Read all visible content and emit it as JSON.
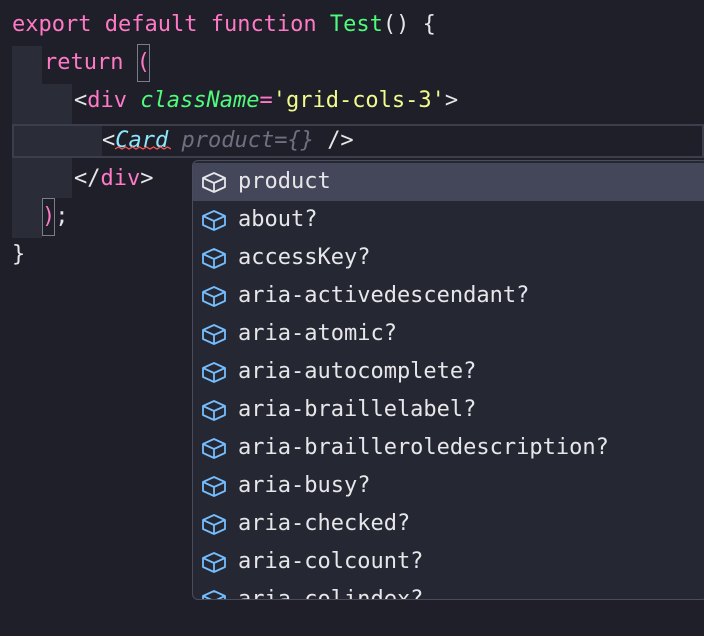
{
  "code": {
    "line1": {
      "kw_export": "export",
      "kw_default": "default",
      "kw_function": "function",
      "fn_name": "Test",
      "parens_brace": "() {"
    },
    "line2": {
      "kw_return": "return",
      "open_paren": "("
    },
    "line3": {
      "lt": "<",
      "tag": "div",
      "attr": "className",
      "eq": "=",
      "value": "'grid-cols-3'",
      "gt": ">"
    },
    "line4": {
      "lt": "<",
      "component": "Card",
      "ghost_hint": "product={}",
      "close": "/>"
    },
    "line5": {
      "close_tag_open": "</",
      "tag": "div",
      "gt": ">"
    },
    "line6": {
      "close_paren": ")",
      "semicolon": ";"
    },
    "line7": {
      "brace": "}"
    }
  },
  "suggestions": {
    "icon": "cube-icon",
    "selected_index": 0,
    "items": [
      "product",
      "about?",
      "accessKey?",
      "aria-activedescendant?",
      "aria-atomic?",
      "aria-autocomplete?",
      "aria-braillelabel?",
      "aria-brailleroledescription?",
      "aria-busy?",
      "aria-checked?",
      "aria-colcount?",
      "aria-colindex?"
    ]
  },
  "colors": {
    "background": "#1e1f29",
    "keyword": "#ff79c6",
    "function": "#50fa7b",
    "string": "#f1fa8c",
    "component": "#8be9fd",
    "icon": "#75beff",
    "error_squiggle": "#ff5555"
  }
}
